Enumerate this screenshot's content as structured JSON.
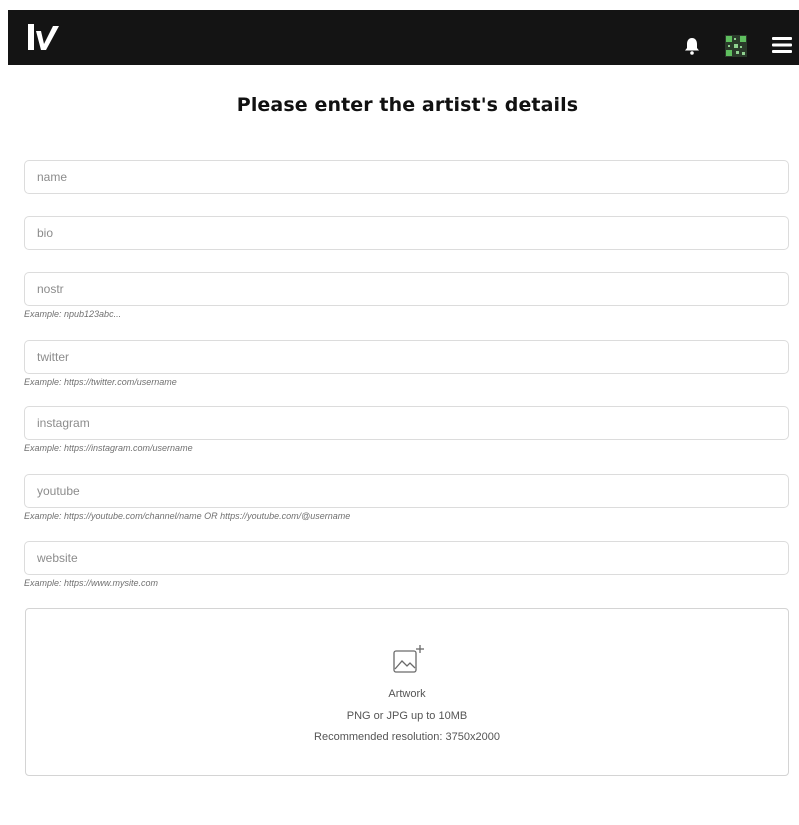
{
  "header": {
    "logo_icon": "lv-logo",
    "notification_icon": "bell-icon",
    "qr_icon": "qr-code-icon",
    "menu_icon": "hamburger-menu-icon",
    "background_color": "#141414"
  },
  "form": {
    "title": "Please enter the artist's details",
    "fields": {
      "name": {
        "placeholder": "name"
      },
      "bio": {
        "placeholder": "bio"
      },
      "nostr": {
        "placeholder": "nostr",
        "hint": "Example: npub123abc..."
      },
      "twitter": {
        "placeholder": "twitter",
        "hint": "Example: https://twitter.com/username"
      },
      "instagram": {
        "placeholder": "instagram",
        "hint": "Example: https://instagram.com/username"
      },
      "youtube": {
        "placeholder": "youtube",
        "hint": "Example: https://youtube.com/channel/name OR https://youtube.com/@username"
      },
      "website": {
        "placeholder": "website",
        "hint": "Example: https://www.mysite.com"
      }
    },
    "artwork": {
      "icon": "image-add-icon",
      "label": "Artwork",
      "formats": "PNG or JPG up to 10MB",
      "resolution": "Recommended resolution: 3750x2000"
    }
  }
}
